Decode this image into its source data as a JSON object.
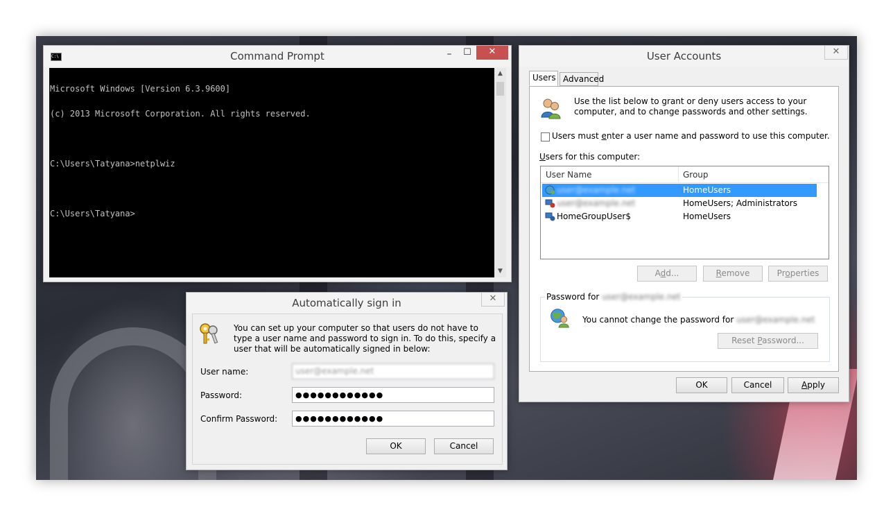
{
  "command_prompt": {
    "title": "Command Prompt",
    "minimize": "–",
    "maximize": "☐",
    "close": "✕",
    "lines": [
      "Microsoft Windows [Version 6.3.9600]",
      "(c) 2013 Microsoft Corporation. All rights reserved.",
      "",
      "C:\\Users\\Tatyana>netplwiz",
      "",
      "C:\\Users\\Tatyana>"
    ],
    "scroll_up": "▲",
    "scroll_down": "▼"
  },
  "auto_sign_in": {
    "title": "Automatically sign in",
    "close": "✕",
    "description": "You can set up your computer so that users do not have to type a user name and password to sign in. To do this, specify a user that will be automatically signed in below:",
    "user_name_label": "User name:",
    "user_name_value": "user@example.net",
    "password_label": "Password:",
    "password_value": "●●●●●●●●●●●●",
    "confirm_label": "Confirm Password:",
    "confirm_value": "●●●●●●●●●●●●",
    "ok": "OK",
    "cancel": "Cancel"
  },
  "user_accounts": {
    "title": "User Accounts",
    "close": "✕",
    "tabs": [
      "Users",
      "Advanced"
    ],
    "intro": "Use the list below to grant or deny users access to your computer, and to change passwords and other settings.",
    "checkbox_label_pre": "Users must ",
    "checkbox_label_mnemonic": "e",
    "checkbox_label_post": "nter a user name and password to use this computer.",
    "list_label_mnemonic": "U",
    "list_label_rest": "sers for this computer:",
    "columns": [
      "User Name",
      "Group"
    ],
    "rows": [
      {
        "name": "user@example.net",
        "group": "HomeUsers",
        "selected": true,
        "blurred": true
      },
      {
        "name": "user@example.net",
        "group": "HomeUsers; Administrators",
        "selected": false,
        "blurred": true
      },
      {
        "name": "HomeGroupUser$",
        "group": "HomeUsers",
        "selected": false,
        "blurred": false
      }
    ],
    "add_pre": "A",
    "add_mnemonic": "d",
    "add_post": "d...",
    "remove_pre": "",
    "remove_mnemonic": "R",
    "remove_post": "emove",
    "properties_pre": "Pr",
    "properties_mnemonic": "o",
    "properties_post": "perties",
    "password_for_label": "Password for",
    "password_for_user": "user@example.net",
    "cannot_change_text": "You cannot change the password for",
    "cannot_change_user": "user@example.net",
    "reset_pre": "Reset ",
    "reset_mnemonic": "P",
    "reset_post": "assword...",
    "ok": "OK",
    "cancel": "Cancel",
    "apply_mnemonic": "A",
    "apply_post": "pply"
  }
}
